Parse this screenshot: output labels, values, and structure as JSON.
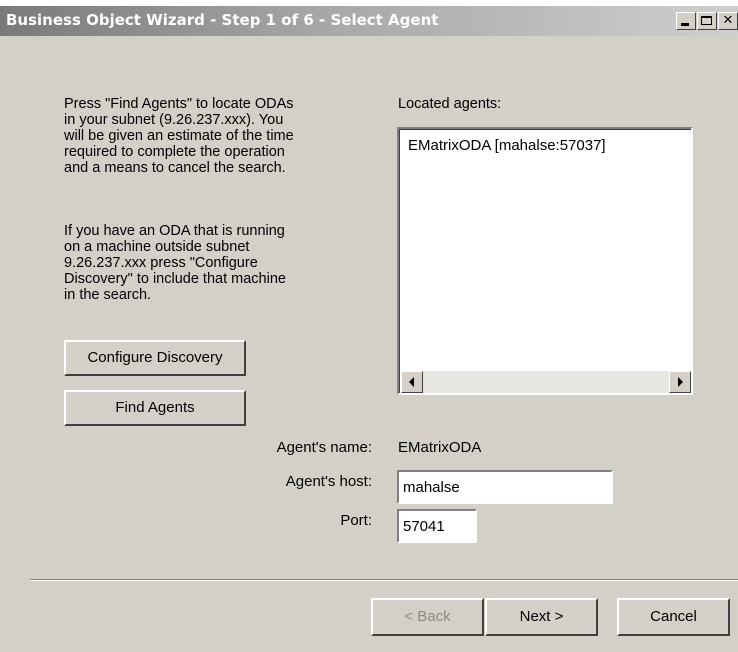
{
  "window": {
    "title": "Business Object Wizard - Step 1 of 6 - Select Agent"
  },
  "instructions": {
    "paragraph1": "Press \"Find Agents\" to locate ODAs\nin your subnet (9.26.237.xxx). You\nwill be given an estimate of the time\nrequired to complete the operation\nand a means to cancel the search.",
    "paragraph2": "If you have an ODA that is running\non a machine outside subnet\n9.26.237.xxx press \"Configure\nDiscovery\" to include that machine\nin the search."
  },
  "buttons": {
    "configure_discovery": "Configure Discovery",
    "find_agents": "Find Agents",
    "back": "< Back",
    "next": "Next >",
    "cancel": "Cancel"
  },
  "agents": {
    "label": "Located agents:",
    "items": [
      "EMatrixODA [mahalse:57037]"
    ]
  },
  "agent_details": {
    "name_label": "Agent's name:",
    "name_value": "EMatrixODA",
    "host_label": "Agent's host:",
    "host_value": "mahalse",
    "port_label": "Port:",
    "port_value": "57041"
  },
  "icons": {
    "minimize": "minimize-icon",
    "maximize": "maximize-icon",
    "close": "close-icon",
    "scroll_left": "arrow-left-icon",
    "scroll_right": "arrow-right-icon"
  }
}
